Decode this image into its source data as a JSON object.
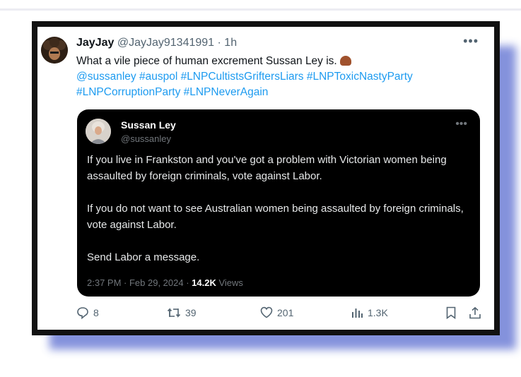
{
  "tweet": {
    "display_name": "JayJay",
    "handle": "@JayJay91341991",
    "time": "· 1h",
    "text": "What a vile piece of human excrement Sussan Ley is.",
    "emoji_icon": "pile-of-poo-icon",
    "tags_line1": "@sussanley #auspol #LNPCultistsGriftersLiars #LNPToxicNastyParty",
    "tags_line2": "#LNPCorruptionParty #LNPNeverAgain"
  },
  "quote": {
    "display_name": "Sussan Ley",
    "handle": "@sussanley",
    "paragraphs": [
      "If you live in Frankston and you've got a problem with Victorian women being assaulted by foreign criminals, vote against Labor.",
      "If you do not want to see Australian women being assaulted by foreign criminals, vote against Labor.",
      "Send Labor a message."
    ],
    "timestamp": "2:37 PM · Feb 29, 2024 · ",
    "views_count": "14.2K",
    "views_label": " Views"
  },
  "actions": {
    "replies": "8",
    "retweets": "39",
    "likes": "201",
    "views": "1.3K"
  },
  "colors": {
    "link": "#1d9bf0",
    "shadow": "#6f7fd6"
  }
}
